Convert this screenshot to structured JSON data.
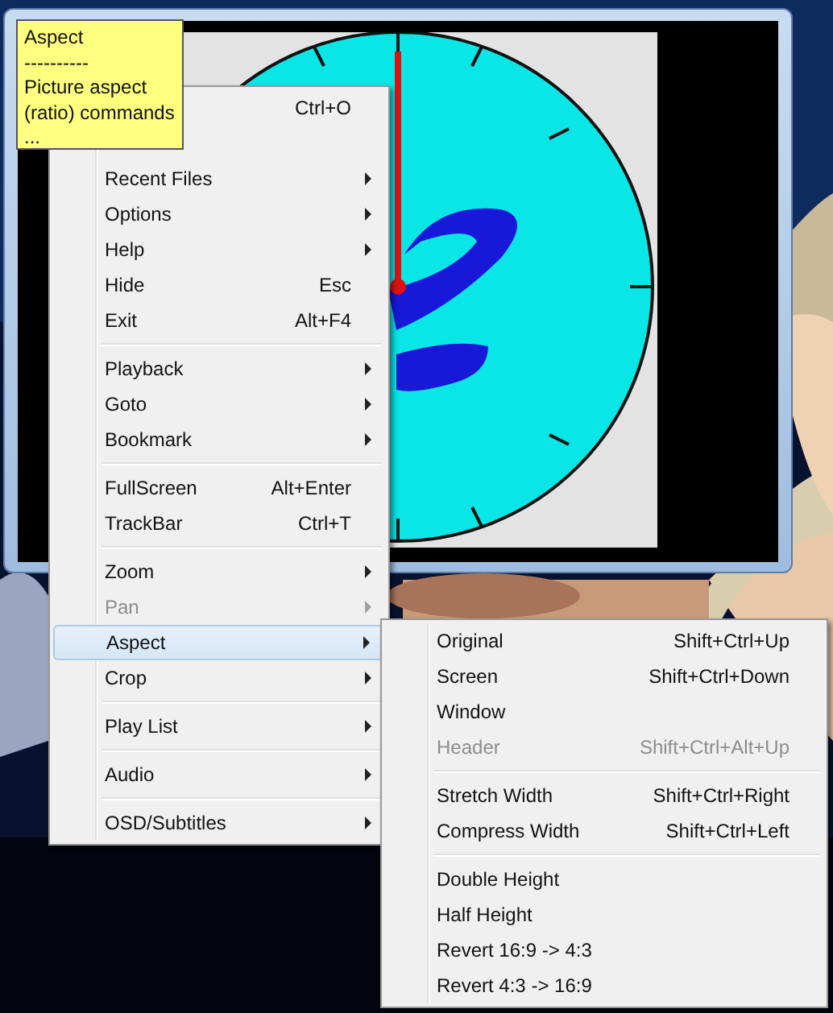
{
  "tooltip": {
    "lines": [
      "Aspect",
      "----------",
      "Picture aspect",
      "(ratio) commands",
      "..."
    ]
  },
  "menu": {
    "groups": [
      [
        {
          "kind": "blank",
          "shortcut": "Ctrl+O"
        },
        {
          "kind": "blank"
        },
        {
          "kind": "item",
          "label": "Recent Files",
          "submenu": true,
          "disabled": false,
          "selected": false
        },
        {
          "kind": "item",
          "label": "Options",
          "submenu": true,
          "disabled": false,
          "selected": false
        },
        {
          "kind": "item",
          "label": "Help",
          "submenu": true,
          "disabled": false,
          "selected": false
        },
        {
          "kind": "item",
          "label": "Hide",
          "shortcut": "Esc",
          "submenu": false,
          "disabled": false,
          "selected": false
        },
        {
          "kind": "item",
          "label": "Exit",
          "shortcut": "Alt+F4",
          "submenu": false,
          "disabled": false,
          "selected": false
        }
      ],
      [
        {
          "kind": "item",
          "label": "Playback",
          "submenu": true,
          "disabled": false,
          "selected": false
        },
        {
          "kind": "item",
          "label": "Goto",
          "submenu": true,
          "disabled": false,
          "selected": false
        },
        {
          "kind": "item",
          "label": "Bookmark",
          "submenu": true,
          "disabled": false,
          "selected": false
        }
      ],
      [
        {
          "kind": "item",
          "label": "FullScreen",
          "shortcut": "Alt+Enter",
          "submenu": false,
          "disabled": false,
          "selected": false
        },
        {
          "kind": "item",
          "label": "TrackBar",
          "shortcut": "Ctrl+T",
          "submenu": false,
          "disabled": false,
          "selected": false
        }
      ],
      [
        {
          "kind": "item",
          "label": "Zoom",
          "submenu": true,
          "disabled": false,
          "selected": false
        },
        {
          "kind": "item",
          "label": "Pan",
          "submenu": true,
          "disabled": true,
          "selected": false
        },
        {
          "kind": "item",
          "label": "Aspect",
          "submenu": true,
          "disabled": false,
          "selected": true
        },
        {
          "kind": "item",
          "label": "Crop",
          "submenu": true,
          "disabled": false,
          "selected": false
        }
      ],
      [
        {
          "kind": "item",
          "label": "Play List",
          "submenu": true,
          "disabled": false,
          "selected": false
        }
      ],
      [
        {
          "kind": "item",
          "label": "Audio",
          "submenu": true,
          "disabled": false,
          "selected": false
        }
      ],
      [
        {
          "kind": "item",
          "label": "OSD/Subtitles",
          "submenu": true,
          "disabled": false,
          "selected": false
        }
      ]
    ]
  },
  "submenu": {
    "groups": [
      [
        {
          "label": "Original",
          "shortcut": "Shift+Ctrl+Up",
          "submenu": false,
          "disabled": false,
          "selected": false
        },
        {
          "label": "Screen",
          "shortcut": "Shift+Ctrl+Down",
          "submenu": false,
          "disabled": false,
          "selected": false
        },
        {
          "label": "Window",
          "submenu": false,
          "disabled": false,
          "selected": false
        },
        {
          "label": "Header",
          "shortcut": "Shift+Ctrl+Alt+Up",
          "submenu": false,
          "disabled": true,
          "selected": false
        }
      ],
      [
        {
          "label": "Stretch Width",
          "shortcut": "Shift+Ctrl+Right",
          "submenu": false,
          "disabled": false,
          "selected": false
        },
        {
          "label": "Compress Width",
          "shortcut": "Shift+Ctrl+Left",
          "submenu": false,
          "disabled": false,
          "selected": false
        }
      ],
      [
        {
          "label": "Double Height",
          "submenu": false,
          "disabled": false,
          "selected": false
        },
        {
          "label": "Half Height",
          "submenu": false,
          "disabled": false,
          "selected": false
        },
        {
          "label": "Revert 16:9 -> 4:3",
          "submenu": false,
          "disabled": false,
          "selected": false
        },
        {
          "label": "Revert 4:3 -> 16:9",
          "submenu": false,
          "disabled": false,
          "selected": false
        }
      ]
    ]
  }
}
